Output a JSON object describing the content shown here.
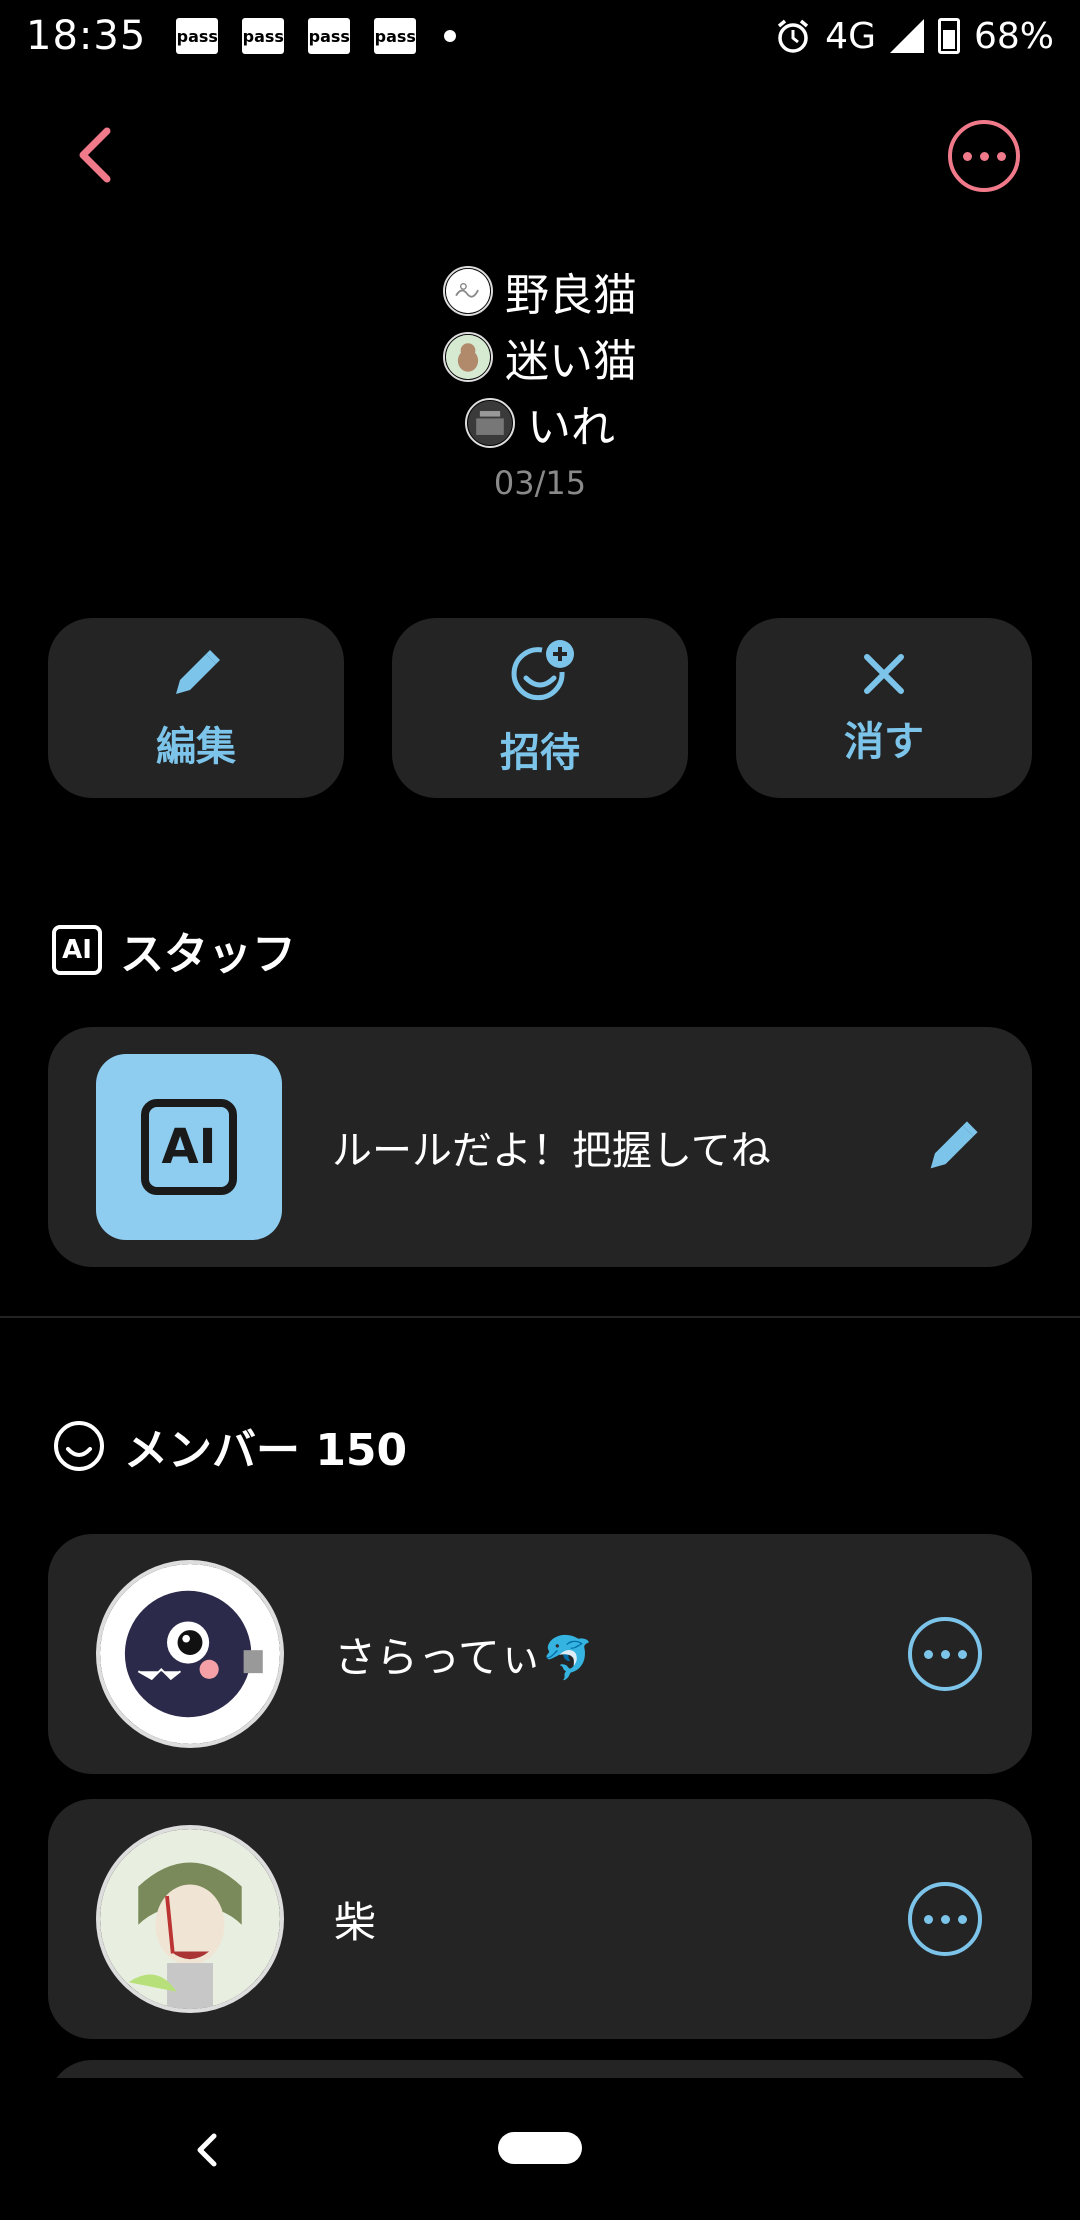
{
  "status_bar": {
    "time": "18:35",
    "pass_label": "pass",
    "network": "4G",
    "battery": "68%"
  },
  "header": {
    "title_lines": [
      "野良猫",
      "迷い猫",
      "いれ"
    ],
    "date": "03/15"
  },
  "actions": [
    {
      "label": "編集",
      "icon": "pencil-icon"
    },
    {
      "label": "招待",
      "icon": "add-person-icon"
    },
    {
      "label": "消す",
      "icon": "close-icon"
    }
  ],
  "staff_section": {
    "title": "スタッフ",
    "icon_text": "AI",
    "item_text": "ルールだよ！把握してね",
    "tile_text": "AI"
  },
  "member_section": {
    "title": "メンバー 150",
    "members": [
      {
        "name": "さらってぃ🐬"
      },
      {
        "name": "柴"
      }
    ]
  },
  "colors": {
    "accent_pink": "#f07a8a",
    "accent_blue": "#7cc4ea",
    "card_bg": "#242424",
    "ai_tile_bg": "#8ecdf0"
  }
}
